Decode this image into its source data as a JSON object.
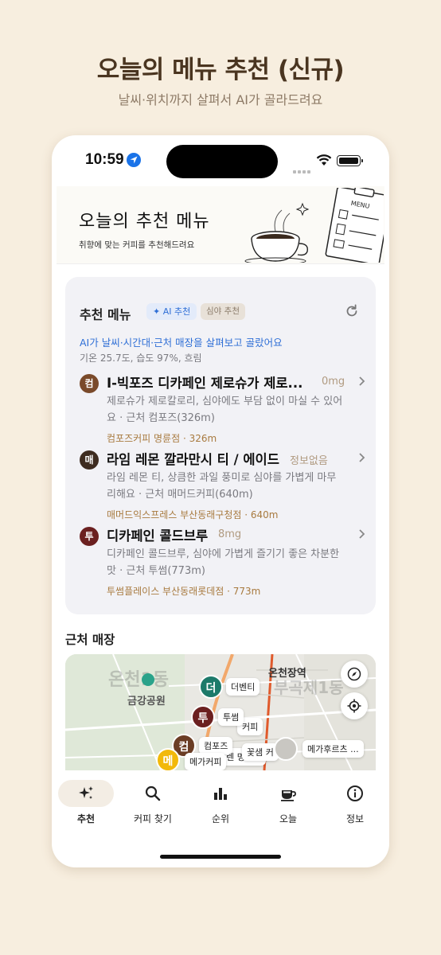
{
  "promo": {
    "title": "오늘의 메뉴 추천 (신규)",
    "subtitle": "날씨·위치까지 살펴서 AI가 골라드려요"
  },
  "status_bar": {
    "time": "10:59"
  },
  "banner": {
    "title": "오늘의 추천 메뉴",
    "subtitle": "취향에 맞는 커피를 추천해드려요",
    "menu_board_text": "MENU"
  },
  "recommend": {
    "title": "추천 메뉴",
    "ai_chip": "AI 추천",
    "night_chip": "심야 추천",
    "ai_note": "AI가 날씨·시간대·근처 매장을 살펴보고 골랐어요",
    "weather": "기온 25.7도, 습도 97%, 흐림",
    "items": [
      {
        "avatar": "컴",
        "avatar_color": "#7a4a2a",
        "name": "I-빅포즈 디카페인 제로슈가 제로...",
        "caffeine": "0mg",
        "desc": "제로슈가 제로칼로리, 심야에도 부담 없이 마실 수 있어요 · 근처 컴포즈(326m)",
        "store": "컴포즈커피 명륜점 · 326m"
      },
      {
        "avatar": "매",
        "avatar_color": "#3e2c20",
        "name": "라임 레몬 깔라만시 티 / 에이드",
        "caffeine": "정보없음",
        "desc": "라임 레몬 티, 상큼한 과일 풍미로 심야를 가볍게 마무리해요 · 근처 매머드커피(640m)",
        "store": "매머드익스프레스 부산동래구청점 · 640m"
      },
      {
        "avatar": "투",
        "avatar_color": "#6b2020",
        "name": "디카페인 콜드브루",
        "caffeine": "8mg",
        "desc": "디카페인 콜드브루, 심야에 가볍게 즐기기 좋은 차분한 맛 · 근처 투썸(773m)",
        "store": "투썸플레이스 부산동래롯데점 · 773m"
      }
    ]
  },
  "nearby": {
    "title": "근처 매장",
    "map": {
      "station_label": "온천장역",
      "park_label": "금강공원",
      "faded_label_1": "온천1동",
      "faded_label_2": "부곡제1동",
      "pins": [
        {
          "glyph": "더",
          "label": "더벤티",
          "color": "#1d7a6a"
        },
        {
          "glyph": "투",
          "label": "투썸",
          "color": "#6b2020"
        },
        {
          "glyph": "컴",
          "label": "컴포즈",
          "color": "#6b3d25"
        },
        {
          "glyph": "메",
          "label": "메가커피",
          "color": "#f2b90a"
        }
      ],
      "extra_tags": [
        "커피",
        "꽃샘 커",
        "메가후르츠 ..."
      ],
      "partial_text": "배렌 명륜점"
    }
  },
  "tabs": [
    {
      "label": "추천",
      "icon": "sparkle-icon",
      "active": true
    },
    {
      "label": "커피 찾기",
      "icon": "search-icon",
      "active": false
    },
    {
      "label": "순위",
      "icon": "bar-chart-icon",
      "active": false
    },
    {
      "label": "오늘",
      "icon": "coffee-cup-icon",
      "active": false
    },
    {
      "label": "정보",
      "icon": "info-icon",
      "active": false
    }
  ]
}
